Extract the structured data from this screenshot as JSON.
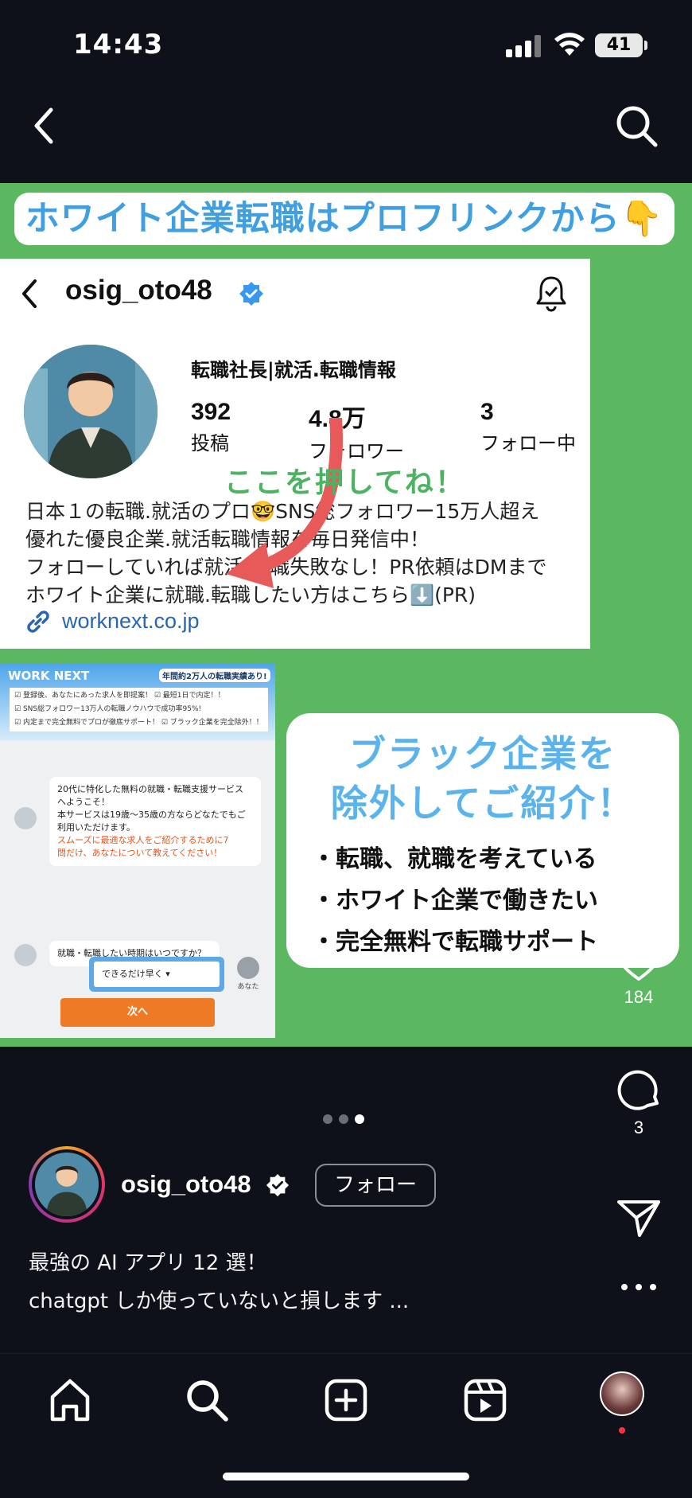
{
  "status_bar": {
    "time": "14:43",
    "battery": "41"
  },
  "post": {
    "headline": "ホワイト企業転職はプロフリンクから👇",
    "profile_card": {
      "username": "osig_oto48",
      "title": "転職社長|就活.転職情報",
      "stats": [
        {
          "value": "392",
          "label": "投稿"
        },
        {
          "value": "4.8万",
          "label": "フォロワー"
        },
        {
          "value": "3",
          "label": "フォロー中"
        }
      ],
      "press_hint": "ここを押してね！",
      "bio": [
        "日本１の転職.就活のプロ🤓SNS総フォロワー15万人超え",
        "優れた優良企業.就活転職情報を毎日発信中！",
        "フォローしていれば就活.転職失敗なし！PR依頼はDMまで",
        "ホワイト企業に就職.転職したい方はこちら⬇️(PR)"
      ],
      "link": "worknext.co.jp"
    },
    "landing": {
      "logo": "WORK NEXT",
      "badge": "年間約2万人の転職実績あり!",
      "checks": [
        "登録後、あなたにあった求人を即提案！",
        "最短1日で内定！！",
        "SNS総フォロワー13万人の転職ノウハウで成功率95%!",
        "内定まで完全無料でプロが徹底サポート！",
        "ブラック企業を完全除外！！"
      ],
      "bubble1_lines": [
        "20代に特化した無料の就職・転職支援サービス",
        "へようこそ！",
        "本サービスは19歳〜35歳の方ならどなたでもご",
        "利用いただけます。",
        "スムーズに最適な求人をご紹介するために7",
        "問だけ、あなたについて教えてください！"
      ],
      "bubble2": "就職・転職したい時期はいつですか？",
      "select_value": "できるだけ早く",
      "you_label": "あなた",
      "next_button": "次へ"
    },
    "promo": {
      "title_line1": "ブラック企業を",
      "title_line2": "除外してご紹介！",
      "items": [
        "・転職、就職を考えている",
        "・ホワイト企業で働きたい",
        "・完全無料で転職サポート"
      ]
    }
  },
  "actions": {
    "likes": "184",
    "comments": "3"
  },
  "carousel": {
    "total": 3,
    "active": 3
  },
  "author": {
    "username": "osig_oto48",
    "follow_label": "フォロー"
  },
  "caption": {
    "line1": "最強の AI アプリ 12 選！",
    "line2": "chatgpt しか使っていないと損します ..."
  },
  "icons": {
    "back": "chevron-left-icon",
    "search": "search-icon",
    "like": "heart-icon",
    "comment": "comment-icon",
    "share": "paper-plane-icon",
    "more": "more-horizontal-icon",
    "home": "home-icon",
    "explore": "search-icon",
    "create": "plus-square-icon",
    "reels": "reels-icon"
  },
  "colors": {
    "background": "#0e111a",
    "post_green": "#5cb860",
    "headline_blue": "#3f9fe0",
    "link_blue": "#2a66b0",
    "verified_blue": "#3897f0",
    "notification_red": "#ff3040"
  }
}
